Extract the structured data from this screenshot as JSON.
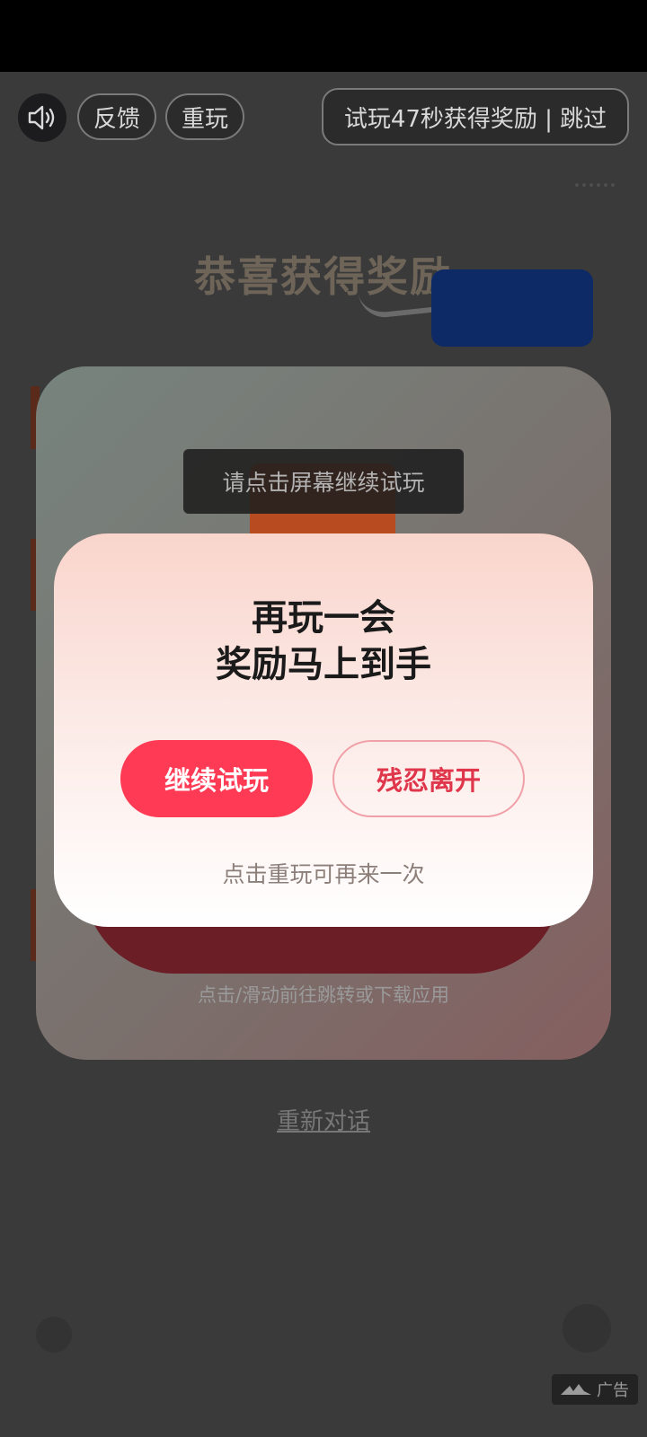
{
  "top_bar": {
    "feedback_label": "反馈",
    "replay_label": "重玩",
    "skip_label": "试玩47秒获得奖励 | 跳过",
    "sound_icon": "speaker-icon"
  },
  "background": {
    "congrats_text": "恭喜获得奖励",
    "toast_text": "请点击屏幕继续试玩",
    "card_hint": "点击/滑动前往跳转或下载应用",
    "restart_link": "重新对话"
  },
  "modal": {
    "title_line1": "再玩一会",
    "title_line2": "奖励马上到手",
    "continue_label": "继续试玩",
    "leave_label": "残忍离开",
    "footnote": "点击重玩可再来一次"
  },
  "ad_badge": {
    "label": "广告"
  },
  "colors": {
    "primary": "#ff3a54",
    "secondary_text": "#e0364c",
    "modal_top": "#f9d5cc"
  }
}
